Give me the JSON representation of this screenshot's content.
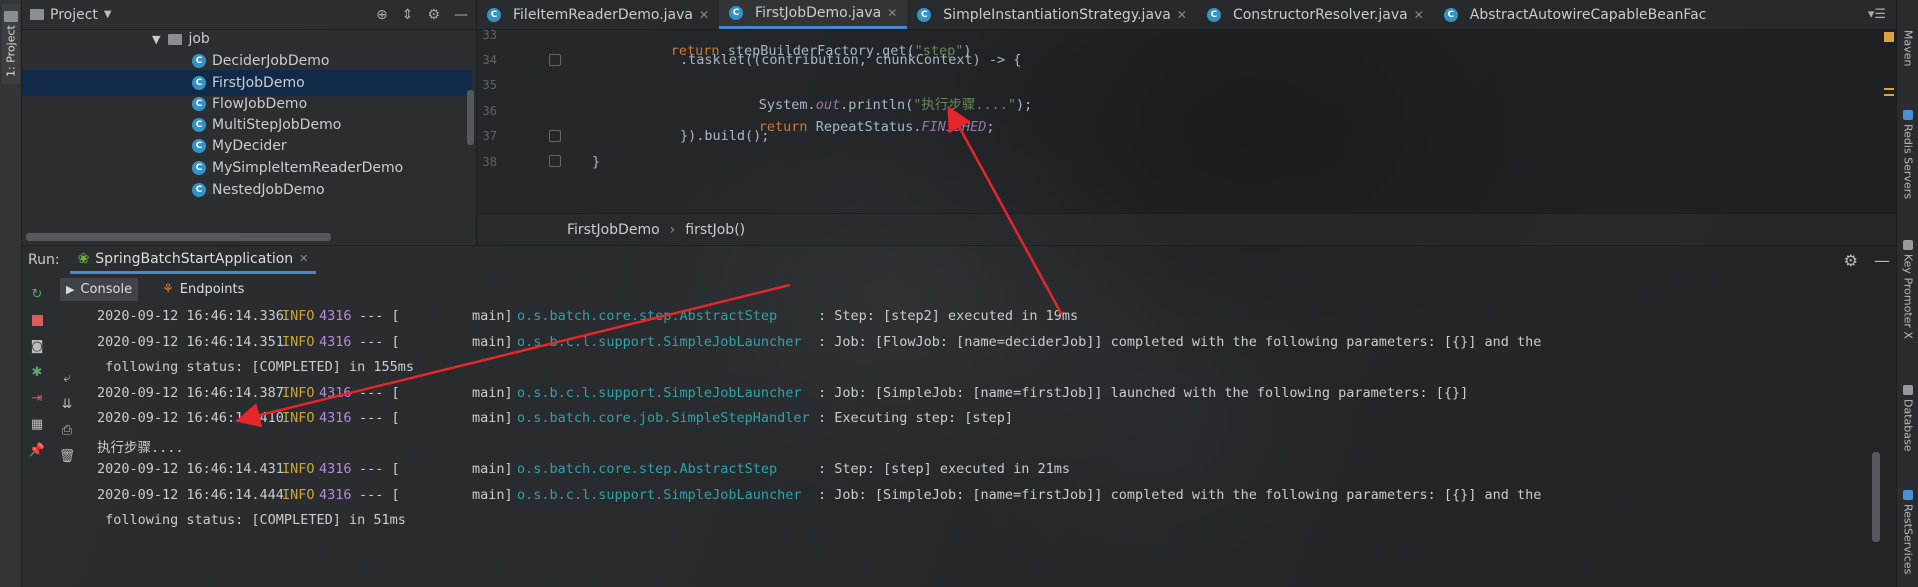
{
  "left_stripe": {
    "project_tab": "1: Project"
  },
  "right_stripe": {
    "tabs": [
      "Maven",
      "Redis Servers",
      "Key Promoter X",
      "Database",
      "RestServices"
    ]
  },
  "project_panel": {
    "title": "Project",
    "folder": "job",
    "items": [
      "DeciderJobDemo",
      "FirstJobDemo",
      "FlowJobDemo",
      "MultiStepJobDemo",
      "MyDecider",
      "MySimpleItemReaderDemo",
      "NestedJobDemo"
    ],
    "selected_item": "FirstJobDemo"
  },
  "editor": {
    "tabs": [
      {
        "label": "FileItemReaderDemo.java"
      },
      {
        "label": "FirstJobDemo.java"
      },
      {
        "label": "SimpleInstantiationStrategy.java"
      },
      {
        "label": "ConstructorResolver.java"
      },
      {
        "label": "AbstractAutowireCapableBeanFac"
      }
    ],
    "active_tab": "FirstJobDemo.java",
    "line_numbers": [
      "33",
      "34",
      "35",
      "36",
      "37",
      "38"
    ],
    "code": {
      "l33_kw": "return",
      "l33_rest": " stepBuilderFactory.get(",
      "l33_str": "\"step\"",
      "l33_end": ")",
      "l34": ".tasklet((contribution, chunkContext) -> {",
      "l35_a": "System.",
      "l35_field": "out",
      "l35_b": ".println(",
      "l35_str": "\"执行步骤....\"",
      "l35_end": ");",
      "l36_kw": "return",
      "l36_a": " RepeatStatus.",
      "l36_field": "FINISHED",
      "l36_end": ";",
      "l37": "}).build();",
      "l38": "}"
    },
    "breadcrumb": [
      "FirstJobDemo",
      "firstJob()"
    ]
  },
  "run_panel": {
    "label": "Run:",
    "config_name": "SpringBatchStartApplication",
    "sub_tabs": [
      "Console",
      "Endpoints"
    ],
    "console_lines": [
      {
        "ts": "2020-09-12 16:46:14.336",
        "lvl": "INFO",
        "pid": "4316",
        "sep": "--- [",
        "thread": "main]",
        "logger": "o.s.batch.core.step.AbstractStep",
        "msg": ": Step: [step2] executed in 19ms"
      },
      {
        "ts": "2020-09-12 16:46:14.351",
        "lvl": "INFO",
        "pid": "4316",
        "sep": "--- [",
        "thread": "main]",
        "logger": "o.s.b.c.l.support.SimpleJobLauncher",
        "msg": ": Job: [FlowJob: [name=deciderJob]] completed with the following parameters: [{}] and the"
      },
      {
        "cont": " following status: [COMPLETED] in 155ms"
      },
      {
        "ts": "2020-09-12 16:46:14.387",
        "lvl": "INFO",
        "pid": "4316",
        "sep": "--- [",
        "thread": "main]",
        "logger": "o.s.b.c.l.support.SimpleJobLauncher",
        "msg": ": Job: [SimpleJob: [name=firstJob]] launched with the following parameters: [{}]"
      },
      {
        "ts": "2020-09-12 16:46:14.410",
        "lvl": "INFO",
        "pid": "4316",
        "sep": "--- [",
        "thread": "main]",
        "logger": "o.s.batch.core.job.SimpleStepHandler",
        "msg": ": Executing step: [step]"
      },
      {
        "cont": "执行步骤...."
      },
      {
        "ts": "2020-09-12 16:46:14.431",
        "lvl": "INFO",
        "pid": "4316",
        "sep": "--- [",
        "thread": "main]",
        "logger": "o.s.batch.core.step.AbstractStep",
        "msg": ": Step: [step] executed in 21ms"
      },
      {
        "ts": "2020-09-12 16:46:14.444",
        "lvl": "INFO",
        "pid": "4316",
        "sep": "--- [",
        "thread": "main]",
        "logger": "o.s.b.c.l.support.SimpleJobLauncher",
        "msg": ": Job: [SimpleJob: [name=firstJob]] completed with the following parameters: [{}] and the"
      },
      {
        "cont": " following status: [COMPLETED] in 51ms"
      }
    ]
  },
  "colors": {
    "accent": "#4a88c7",
    "keyword": "#cc7832",
    "string": "#6a8759",
    "field": "#9876aa",
    "log_level": "#c9a636",
    "logger": "#2ea2a8",
    "annotation_arrow": "#e5262b"
  }
}
